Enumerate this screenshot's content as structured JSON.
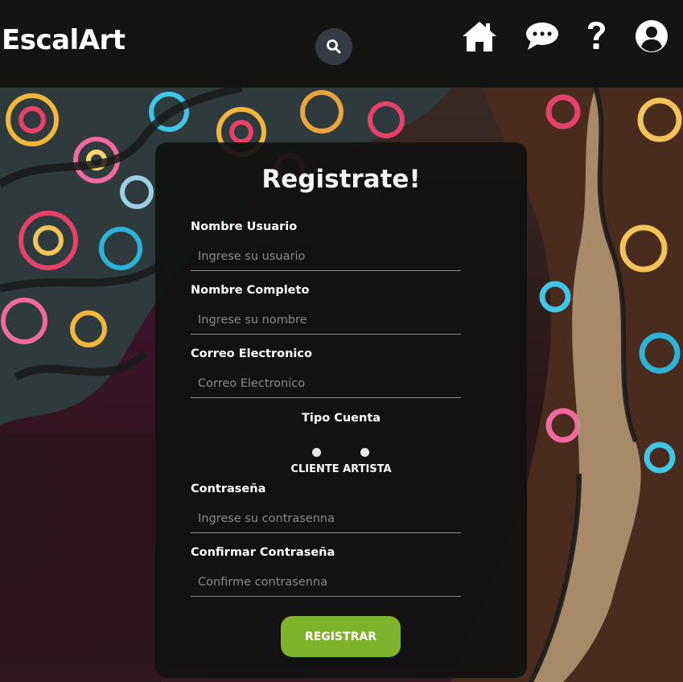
{
  "header": {
    "brand": "EscalArt",
    "icons": [
      "search-icon",
      "home-icon",
      "chat-icon",
      "help-icon",
      "user-icon"
    ]
  },
  "form": {
    "title": "Registrate!",
    "username": {
      "label": "Nombre Usuario",
      "placeholder": "Ingrese su usuario"
    },
    "fullname": {
      "label": "Nombre Completo",
      "placeholder": "Ingrese su nombre"
    },
    "email": {
      "label": "Correo Electronico",
      "placeholder": "Correo Electronico"
    },
    "account_type": {
      "label": "Tipo Cuenta",
      "options": [
        "CLIENTE",
        "ARTISTA"
      ]
    },
    "password": {
      "label": "Contraseña",
      "placeholder": "Ingrese su contrasenna"
    },
    "confirm_password": {
      "label": "Confirmar Contraseña",
      "placeholder": "Confirme contrasenna"
    },
    "submit_label": "REGISTRAR"
  },
  "colors": {
    "header_bg": "#141413",
    "card_bg": "#111111",
    "submit_bg": "#7fb32c",
    "search_bg": "#363b42"
  }
}
